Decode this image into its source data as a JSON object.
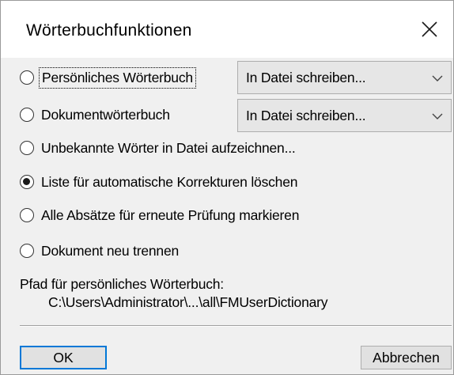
{
  "dialog": {
    "title": "Wörterbuchfunktionen",
    "close_icon": "close-icon"
  },
  "options": [
    {
      "label": "Persönliches Wörterbuch",
      "checked": false,
      "focused": true,
      "has_dropdown": true,
      "dropdown_value": "In Datei schreiben..."
    },
    {
      "label": "Dokumentwörterbuch",
      "checked": false,
      "focused": false,
      "has_dropdown": true,
      "dropdown_value": "In Datei schreiben..."
    },
    {
      "label": "Unbekannte Wörter in Datei aufzeichnen...",
      "checked": false,
      "focused": false,
      "has_dropdown": false
    },
    {
      "label": "Liste für automatische Korrekturen löschen",
      "checked": true,
      "focused": false,
      "has_dropdown": false
    },
    {
      "label": "Alle Absätze für erneute Prüfung markieren",
      "checked": false,
      "focused": false,
      "has_dropdown": false
    },
    {
      "label": "Dokument neu trennen",
      "checked": false,
      "focused": false,
      "has_dropdown": false
    }
  ],
  "path": {
    "label": "Pfad für persönliches Wörterbuch:",
    "value": "C:\\Users\\Administrator\\...\\all\\FMUserDictionary"
  },
  "buttons": {
    "ok_label": "OK",
    "cancel_label": "Abbrechen"
  },
  "colors": {
    "default_button_border": "#0078d7",
    "dialog_background": "#f0f0f0",
    "titlebar_background": "#ffffff"
  }
}
